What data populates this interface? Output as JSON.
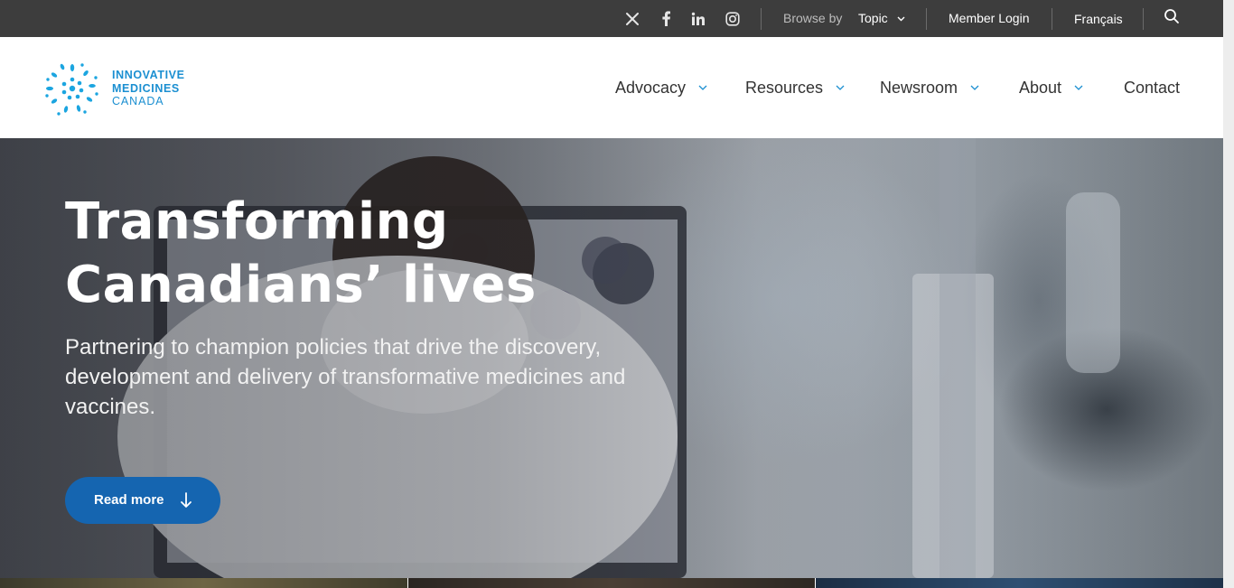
{
  "topbar": {
    "social": [
      {
        "icon": "x-twitter-icon"
      },
      {
        "icon": "facebook-icon"
      },
      {
        "icon": "linkedin-icon"
      },
      {
        "icon": "instagram-icon"
      }
    ],
    "browse_label": "Browse by",
    "browse_value": "Topic",
    "member_login": "Member Login",
    "language": "Français",
    "search_icon": "search-icon"
  },
  "header": {
    "logo": {
      "line1": "INNOVATIVE",
      "line2": "MEDICINES",
      "line3": "CANADA",
      "color": "#1b8fd1"
    },
    "nav": [
      {
        "label": "Advocacy",
        "has_dropdown": true
      },
      {
        "label": "Resources",
        "has_dropdown": true
      },
      {
        "label": "Newsroom",
        "has_dropdown": true
      },
      {
        "label": "About",
        "has_dropdown": true
      },
      {
        "label": "Contact",
        "has_dropdown": false
      }
    ]
  },
  "hero": {
    "title_line1": "Transforming",
    "title_line2": "Canadians’ lives",
    "subtitle": "Partnering to champion policies that drive the discovery, development and delivery of transformative medicines and vaccines.",
    "cta_label": "Read more",
    "cta_color": "#1565b0"
  },
  "colors": {
    "topbar_bg": "#3d3d3d",
    "nav_text": "#333333",
    "accent_blue": "#1b8fd1"
  }
}
